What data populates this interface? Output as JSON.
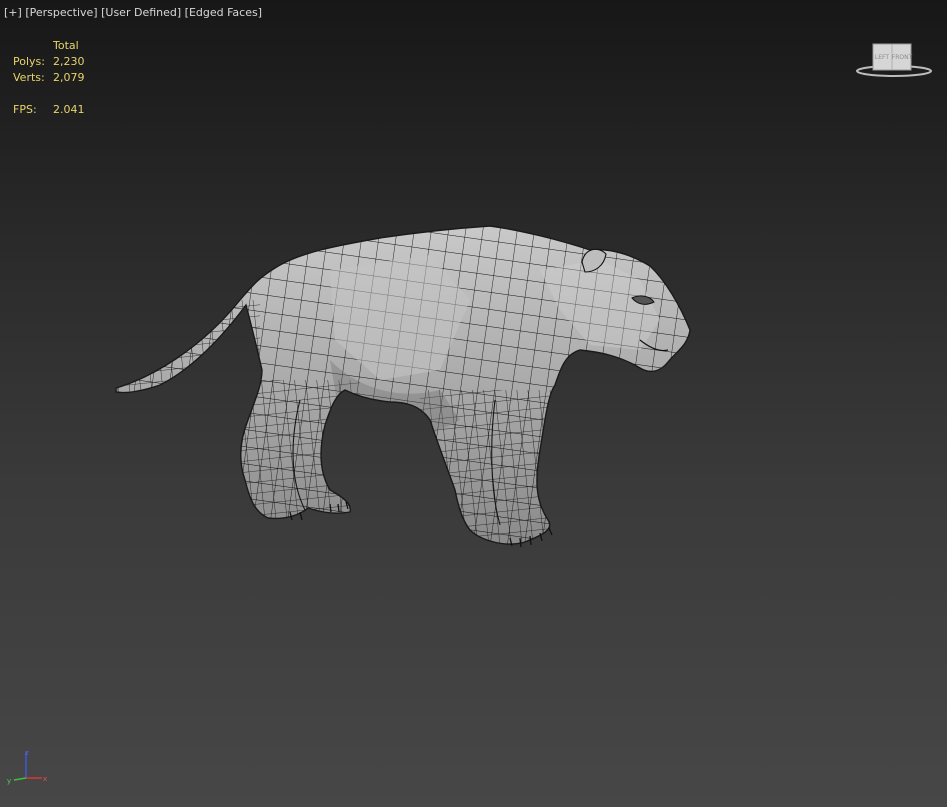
{
  "viewport": {
    "label_parts": [
      "[+]",
      "[Perspective]",
      "[User Defined]",
      "[Edged Faces]"
    ]
  },
  "stats": {
    "header": "Total",
    "polys_label": "Polys:",
    "polys_value": "2,230",
    "verts_label": "Verts:",
    "verts_value": "2,079",
    "fps_label": "FPS:",
    "fps_value": "2.041"
  },
  "viewcube": {
    "left_face": "LEFT",
    "front_face": "FRONT"
  },
  "axis": {
    "x": "x",
    "y": "y",
    "z": "z"
  },
  "colors": {
    "stats_text": "#e7d36b",
    "label_text": "#d8d8d8",
    "mesh_fill": "#9c9c9c",
    "wire": "#111111"
  },
  "icons": [
    "viewcube-icon",
    "axis-tripod-icon"
  ]
}
